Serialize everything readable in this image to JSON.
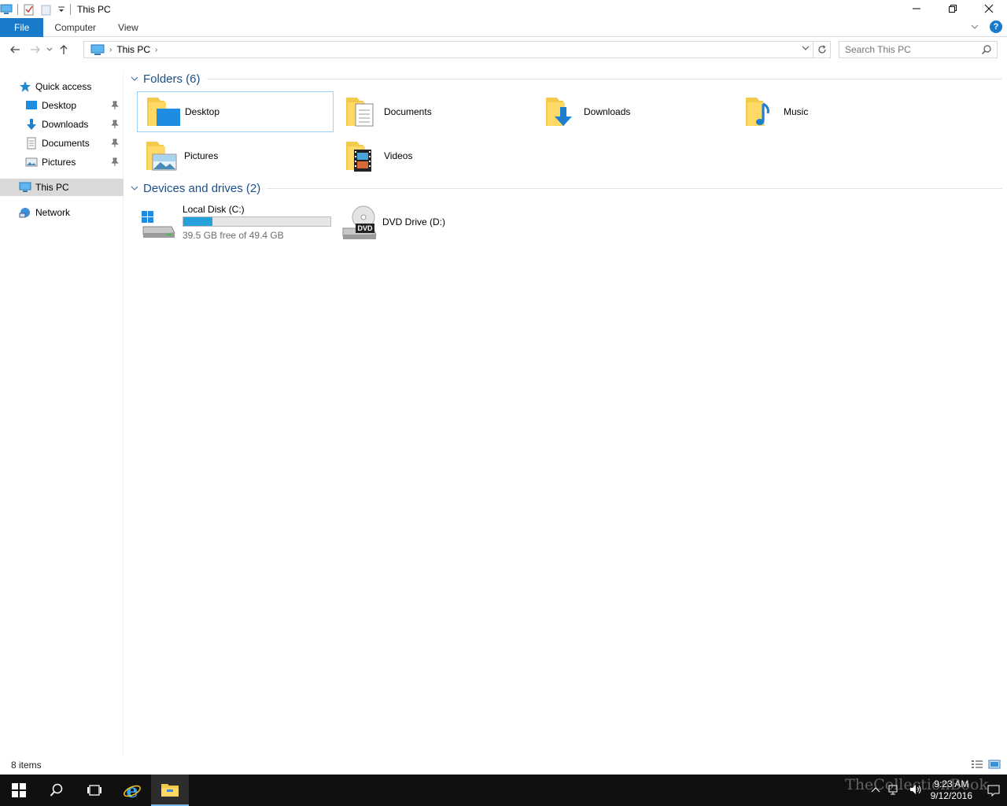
{
  "window": {
    "title": "This PC"
  },
  "ribbon": {
    "tabs": [
      "File",
      "Computer",
      "View"
    ]
  },
  "address": {
    "location": "This PC",
    "search_placeholder": "Search This PC"
  },
  "nav": {
    "quick_access": "Quick access",
    "pinned": [
      {
        "label": "Desktop",
        "icon": "desktop-icon"
      },
      {
        "label": "Downloads",
        "icon": "downloads-icon"
      },
      {
        "label": "Documents",
        "icon": "documents-icon"
      },
      {
        "label": "Pictures",
        "icon": "pictures-icon"
      }
    ],
    "this_pc": "This PC",
    "network": "Network"
  },
  "folders": {
    "header": "Folders (6)",
    "items": [
      "Desktop",
      "Documents",
      "Downloads",
      "Music",
      "Pictures",
      "Videos"
    ]
  },
  "drives": {
    "header": "Devices and drives (2)",
    "local": {
      "name": "Local Disk (C:)",
      "free_text": "39.5 GB free of 49.4 GB",
      "used_fraction": 0.2
    },
    "dvd": {
      "name": "DVD Drive (D:)"
    }
  },
  "status": {
    "count": "8 items"
  },
  "taskbar": {
    "time": "9:23 AM",
    "date": "9/12/2016",
    "watermark": "TheCollectionBook"
  },
  "colors": {
    "accent": "#1979ca",
    "bar": "#26a0da",
    "taskbar": "#101010"
  }
}
